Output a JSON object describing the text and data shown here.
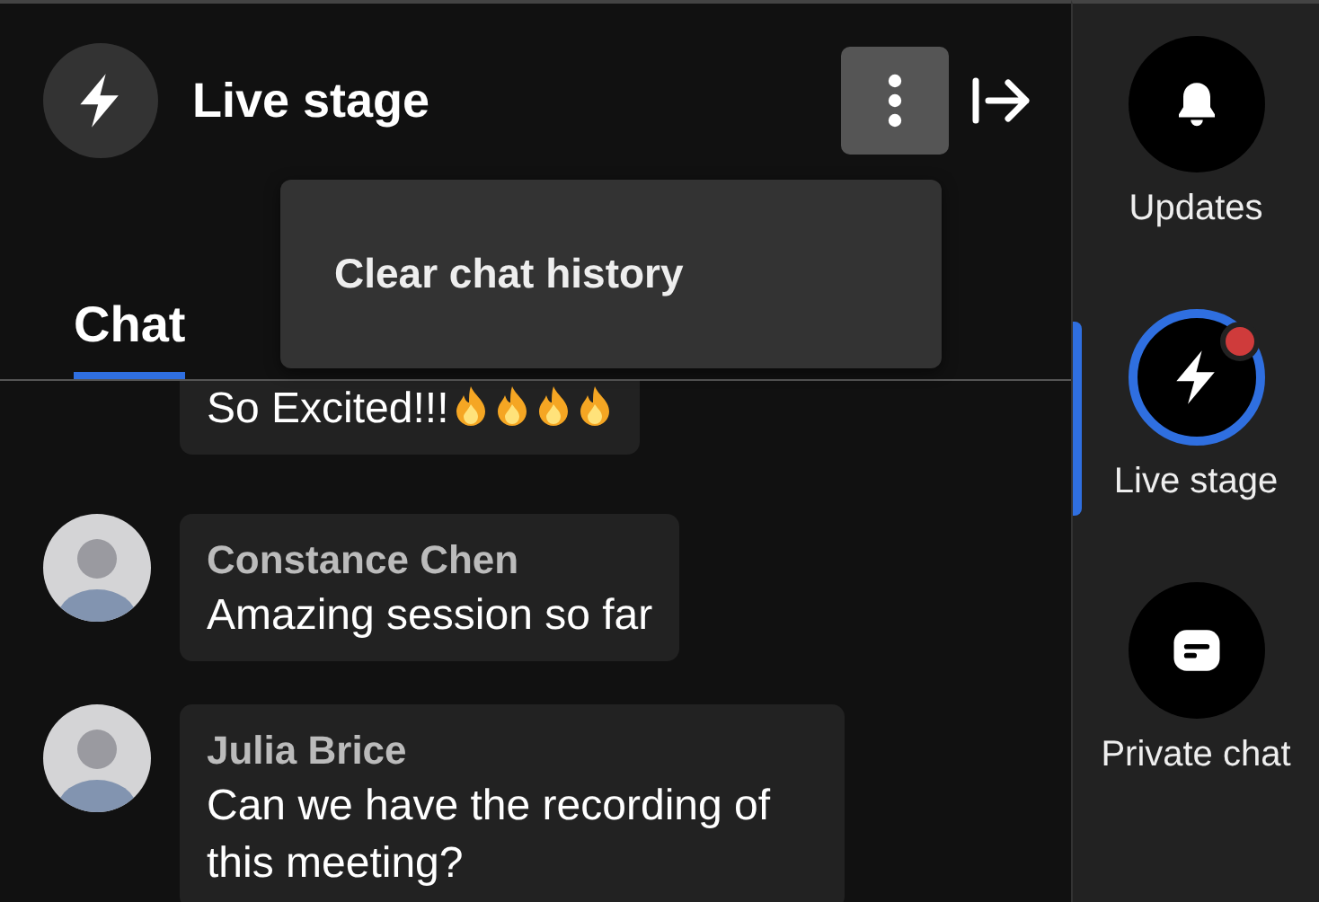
{
  "header": {
    "title": "Live stage",
    "menu_open": true,
    "menu_items": [
      "Clear chat history"
    ]
  },
  "tabs": [
    {
      "label": "Chat",
      "selected": true
    }
  ],
  "messages": [
    {
      "text": "So Excited!!!",
      "icons": [
        {
          "kind": "fire"
        },
        {
          "kind": "fire"
        },
        {
          "kind": "fire"
        },
        {
          "kind": "fire"
        }
      ]
    },
    {
      "name": "Constance Chen",
      "text": "Amazing session so far"
    },
    {
      "name": "Julia Brice",
      "text": "Can we have the recording of this meeting?"
    }
  ],
  "sidebar": {
    "items": [
      {
        "label": "Updates",
        "selected": false,
        "notification": false
      },
      {
        "label": "Live stage",
        "selected": true,
        "notification": true
      },
      {
        "label": "Private chat",
        "selected": false,
        "notification": false
      }
    ]
  }
}
